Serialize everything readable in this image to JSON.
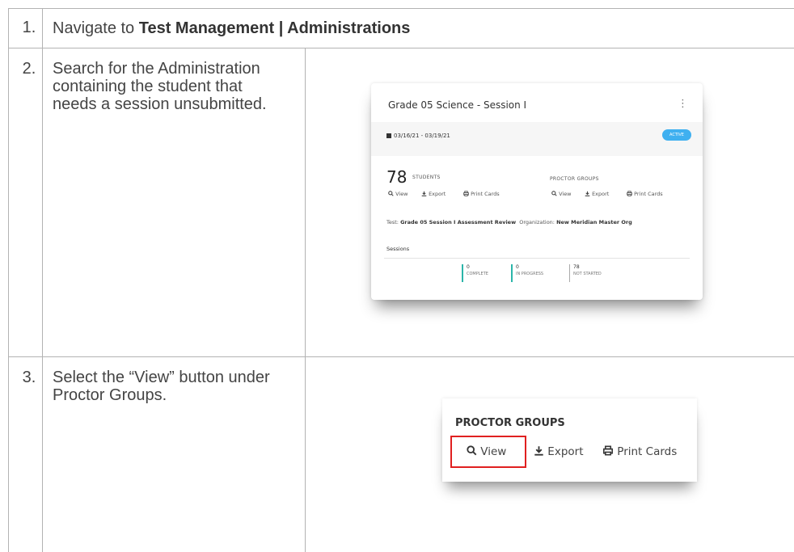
{
  "steps": [
    {
      "number": "1.",
      "prefix": "Navigate to ",
      "bold": "Test Management | Administrations"
    },
    {
      "number": "2.",
      "text": "Search for the Administration containing the student that needs a session unsubmitted."
    },
    {
      "number": "3.",
      "text": "Select the “View” button under Proctor Groups."
    }
  ],
  "card": {
    "title": "Grade 05 Science - Session I",
    "kebab": "⋮",
    "date_range": "03/16/21 - 03/19/21",
    "status_badge": "ACTIVE",
    "student_count": "78",
    "students_label": "STUDENTS",
    "proctor_groups_label": "PROCTOR GROUPS",
    "view_label": "View",
    "export_label": "Export",
    "print_label": "Print Cards",
    "test_prefix": "Test: ",
    "test_value": "Grade 05 Session I Assessment Review",
    "org_prefix": "Organization: ",
    "org_value": "New Meridian Master Org",
    "sessions_label": "Sessions",
    "stats": [
      {
        "value": "0",
        "label": "COMPLETE"
      },
      {
        "value": "0",
        "label": "IN PROGRESS"
      },
      {
        "value": "78",
        "label": "NOT STARTED"
      }
    ],
    "badge_color": "#3fb0f0"
  },
  "zoom": {
    "title": "PROCTOR GROUPS",
    "view_label": "View",
    "export_label": "Export",
    "print_label": "Print Cards",
    "highlight_color": "#e02020"
  },
  "icons": {
    "search": "search-icon",
    "download": "download-icon",
    "print": "print-icon",
    "calendar": "calendar-icon"
  }
}
